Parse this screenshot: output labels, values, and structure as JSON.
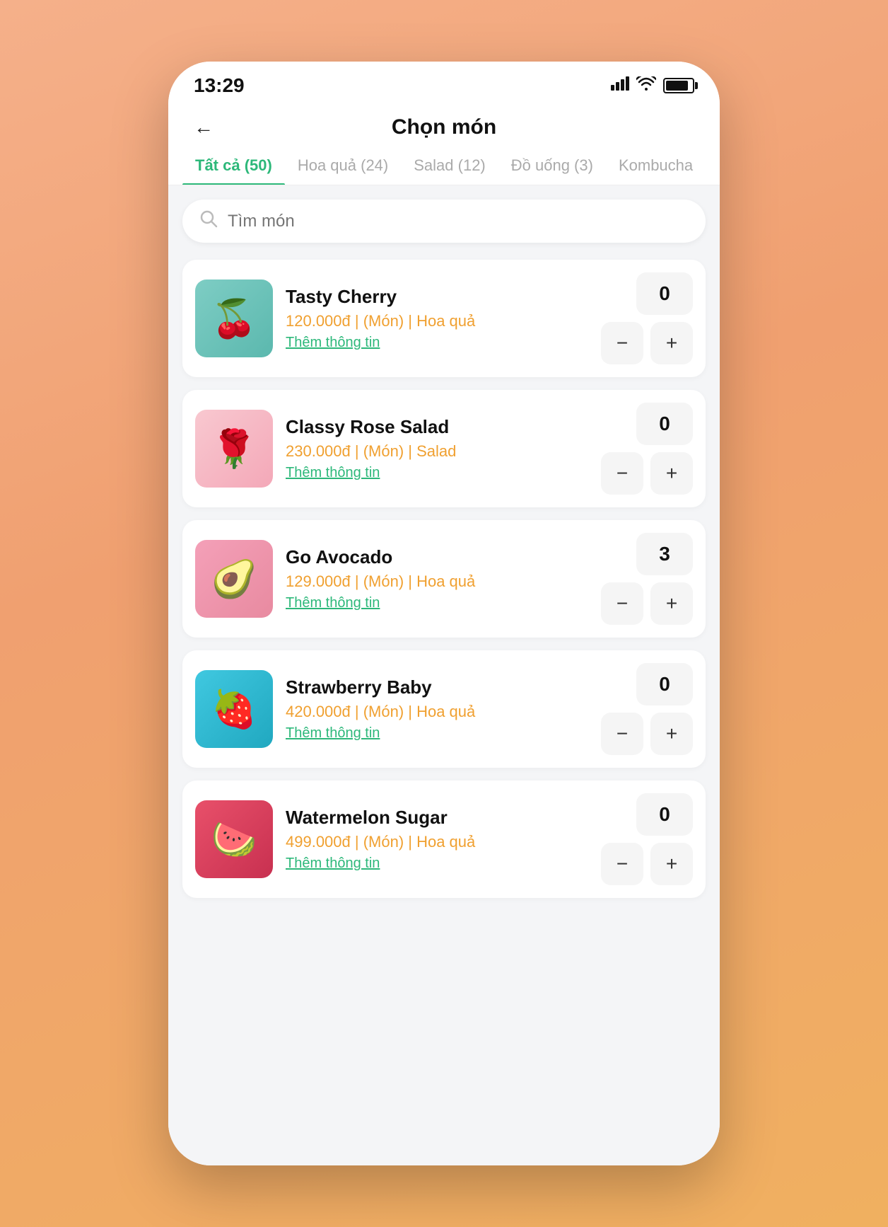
{
  "statusBar": {
    "time": "13:29"
  },
  "header": {
    "backLabel": "←",
    "title": "Chọn món"
  },
  "tabs": [
    {
      "id": "all",
      "label": "Tất cả (50)",
      "active": true
    },
    {
      "id": "fruit",
      "label": "Hoa quả (24)",
      "active": false
    },
    {
      "id": "salad",
      "label": "Salad (12)",
      "active": false
    },
    {
      "id": "drinks",
      "label": "Đồ uống (3)",
      "active": false
    },
    {
      "id": "kombucha",
      "label": "Kombucha",
      "active": false
    }
  ],
  "search": {
    "placeholder": "Tìm món"
  },
  "menuItems": [
    {
      "id": "item1",
      "name": "Tasty Cherry",
      "price": "120.000đ | (Món) | Hoa quả",
      "moreInfo": "Thêm thông tin",
      "qty": "0",
      "imageClass": "img-cherry",
      "emoji": "🍒"
    },
    {
      "id": "item2",
      "name": "Classy Rose Salad",
      "price": "230.000đ | (Món) | Salad",
      "moreInfo": "Thêm thông tin",
      "qty": "0",
      "imageClass": "img-salad",
      "emoji": "🌹"
    },
    {
      "id": "item3",
      "name": "Go Avocado",
      "price": "129.000đ | (Món) | Hoa quả",
      "moreInfo": "Thêm thông tin",
      "qty": "3",
      "imageClass": "img-avocado",
      "emoji": "🥑"
    },
    {
      "id": "item4",
      "name": "Strawberry Baby",
      "price": "420.000đ | (Món) | Hoa quả",
      "moreInfo": "Thêm thông tin",
      "qty": "0",
      "imageClass": "img-strawberry",
      "emoji": "🍓"
    },
    {
      "id": "item5",
      "name": "Watermelon Sugar",
      "price": "499.000đ | (Món) | Hoa quả",
      "moreInfo": "Thêm thông tin",
      "qty": "0",
      "imageClass": "img-watermelon",
      "emoji": "🍉"
    }
  ]
}
